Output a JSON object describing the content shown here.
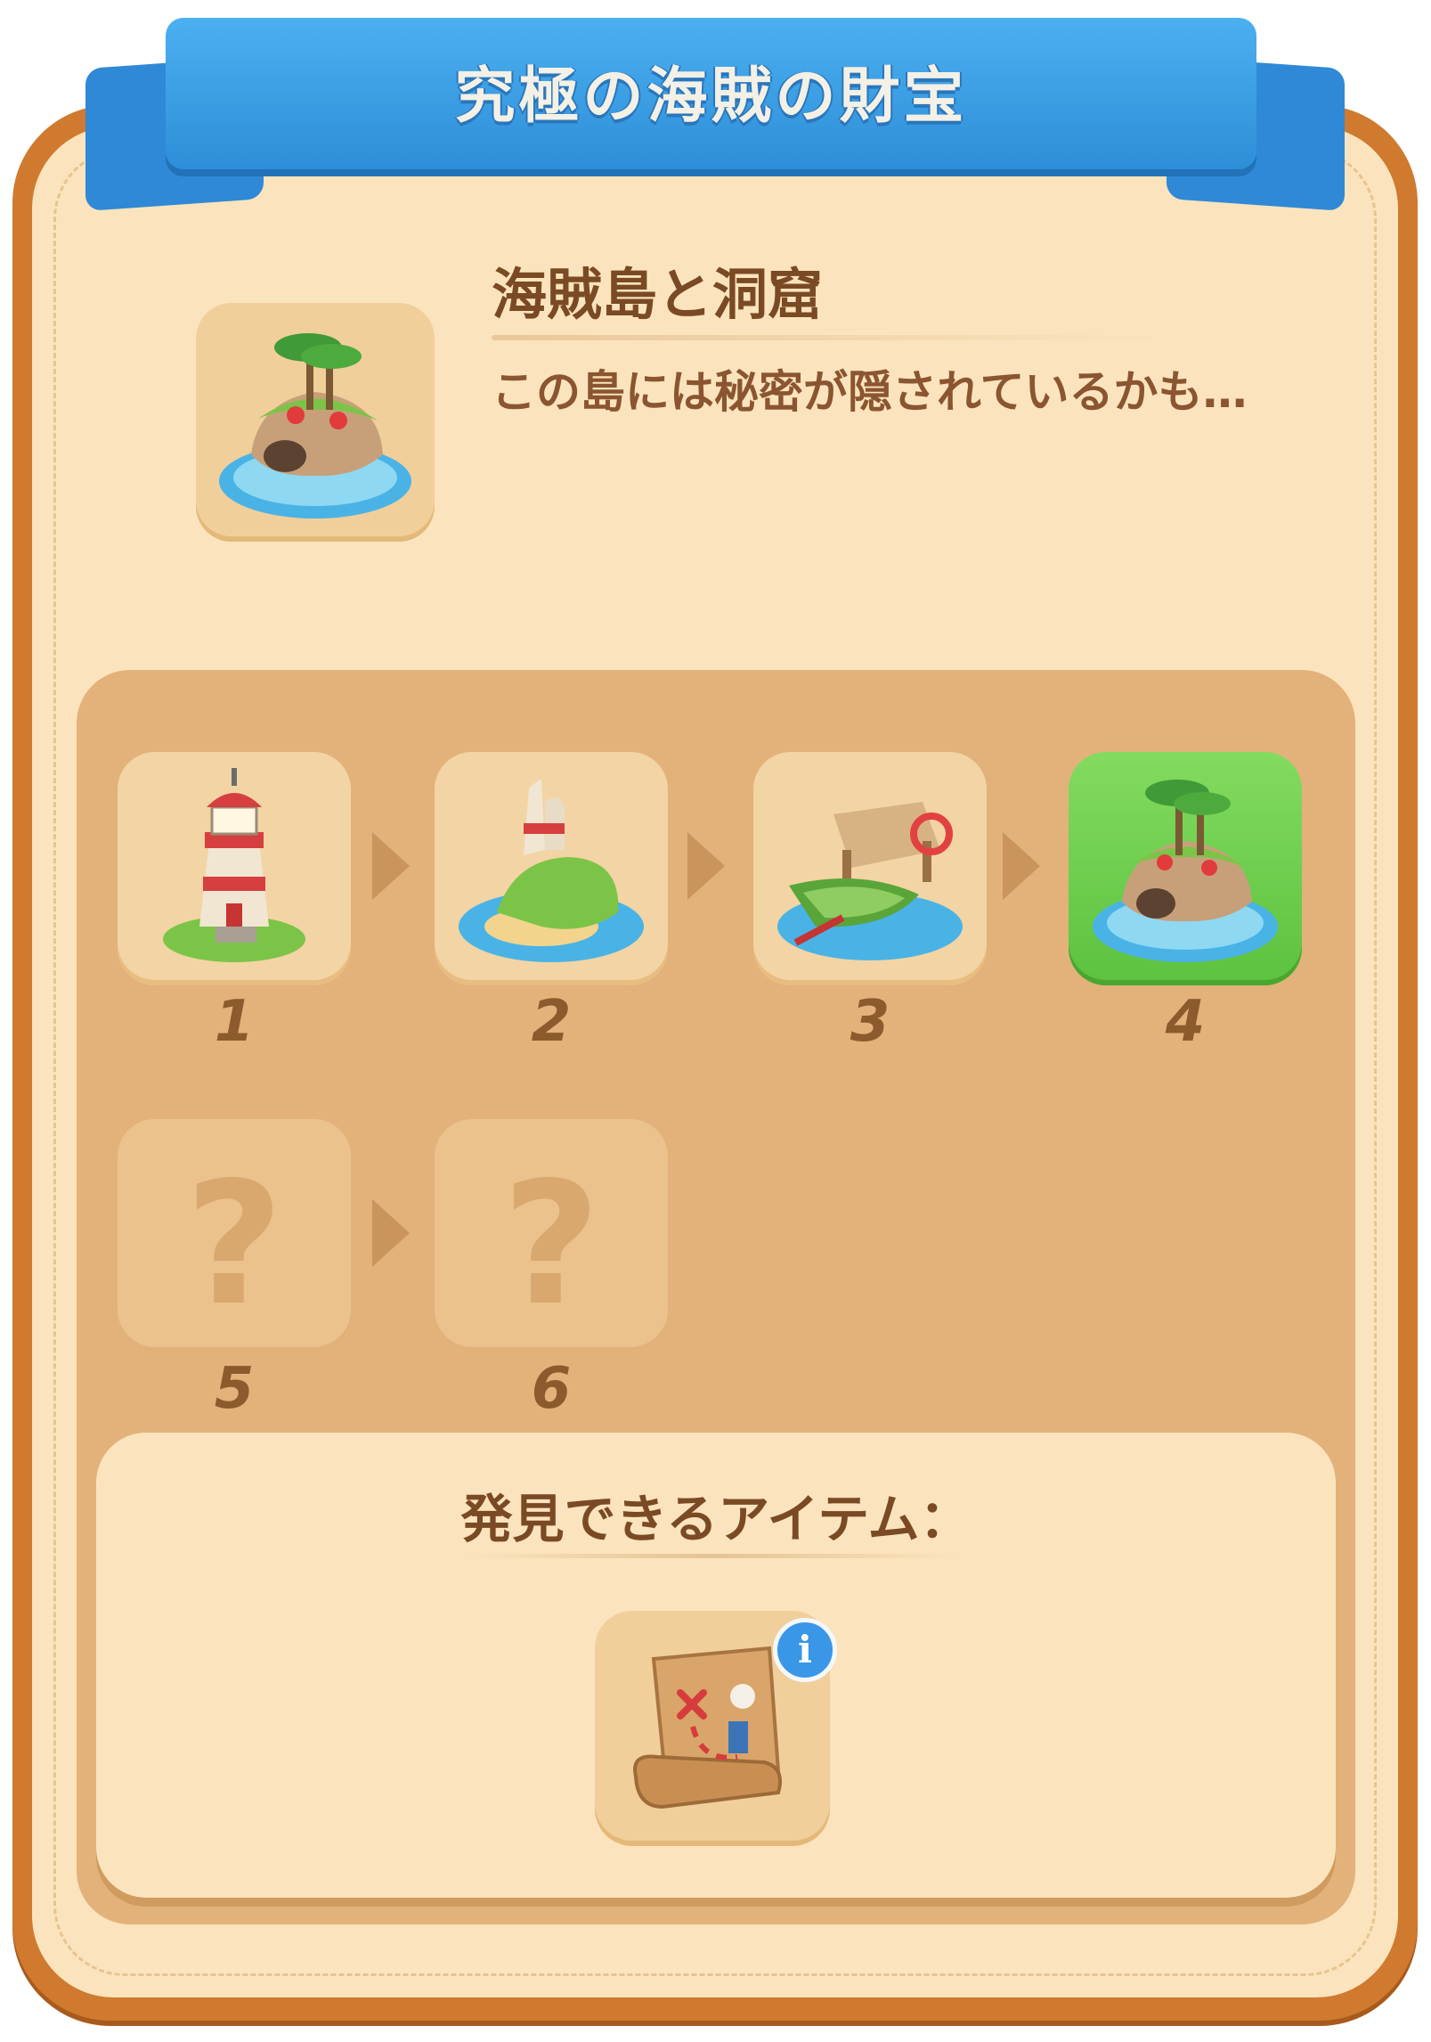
{
  "header": {
    "title": "究極の海賊の財宝"
  },
  "current": {
    "name": "海賊島と洞窟",
    "description": "この島には秘密が隠されているかも…",
    "icon": "pirate-island-cave-icon"
  },
  "steps": [
    {
      "number": "1",
      "icon": "lighthouse-icon",
      "state": "completed"
    },
    {
      "number": "2",
      "icon": "ruined-tower-island-icon",
      "state": "completed"
    },
    {
      "number": "3",
      "icon": "dock-rowboat-icon",
      "state": "completed"
    },
    {
      "number": "4",
      "icon": "pirate-island-cave-icon",
      "state": "current"
    },
    {
      "number": "5",
      "icon": "question-mark-icon",
      "state": "locked",
      "glyph": "?"
    },
    {
      "number": "6",
      "icon": "question-mark-icon",
      "state": "locked",
      "glyph": "?"
    }
  ],
  "discoverable": {
    "label": "発見できるアイテム：",
    "items": [
      {
        "icon": "treasure-map-icon",
        "info_glyph": "i"
      }
    ]
  },
  "colors": {
    "ribbon": "#2e8ed8",
    "frame": "#cf7a2e",
    "panel": "#e2b27a",
    "current_tile": "#5cc23f"
  }
}
